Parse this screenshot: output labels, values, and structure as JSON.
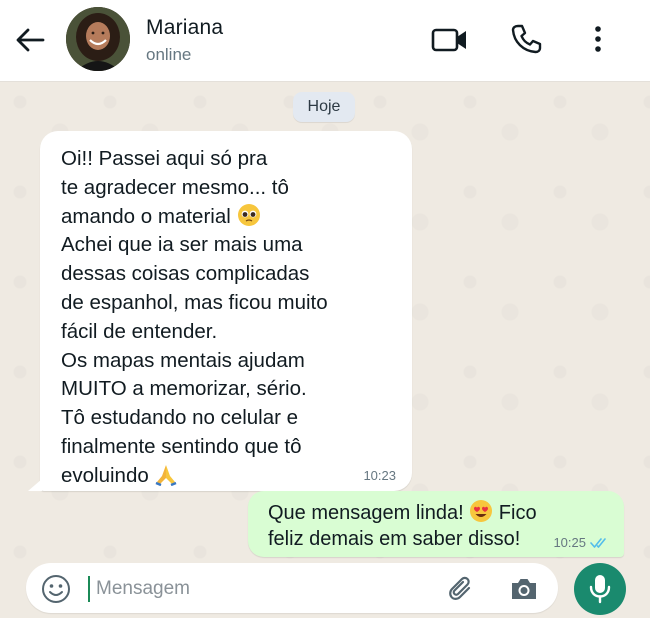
{
  "header": {
    "contact_name": "Mariana",
    "status": "online",
    "icons": [
      "back-arrow-icon",
      "video-camera-icon",
      "phone-icon",
      "more-vertical-icon"
    ]
  },
  "date_chip": "Hoje",
  "messages": [
    {
      "direction": "incoming",
      "lines": [
        "Oi!! Passei aqui só pra",
        "te agradecer mesmo... tô",
        "amando o material",
        "Achei que ia ser mais uma",
        "dessas coisas complicadas",
        "de espanhol, mas ficou muito",
        "fácil de entender.",
        "Os mapas mentais ajudam",
        "MUITO a memorizar, sério.",
        "Tô estudando no celular e",
        "finalmente sentindo que tô",
        "evoluindo"
      ],
      "emojis": [
        "pleading-face-emoji",
        "folded-hands-emoji"
      ],
      "time": "10:23"
    },
    {
      "direction": "outgoing",
      "line1": "Que mensagem linda!",
      "line1b": "Fico",
      "line2": "feliz demais em saber disso!",
      "emojis": [
        "heart-eyes-emoji"
      ],
      "time": "10:25",
      "status": "read"
    }
  ],
  "composer": {
    "placeholder": "Mensagem",
    "value": ""
  },
  "colors": {
    "outgoing_bubble": "#d9fdd3",
    "incoming_bubble": "#ffffff",
    "accent": "#1a8a6e",
    "read_ticks": "#53bdeb"
  }
}
